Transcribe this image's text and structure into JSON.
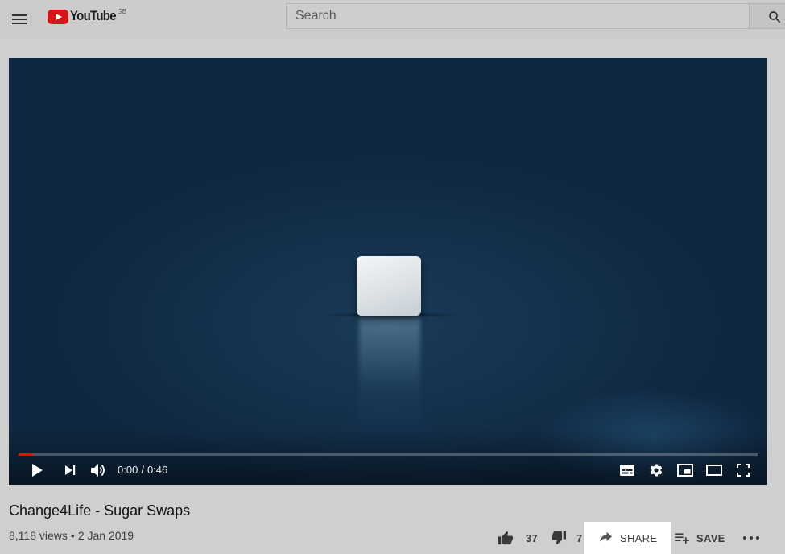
{
  "header": {
    "logo_text": "YouTube",
    "country_code": "GB",
    "search_placeholder": "Search"
  },
  "player": {
    "current_time": "0:00",
    "separator": "/",
    "duration": "0:46",
    "progress_fraction": 0.02
  },
  "video": {
    "title": "Change4Life - Sugar Swaps",
    "views": "8,118 views",
    "dot": "•",
    "date": "2 Jan 2019"
  },
  "actions": {
    "likes": "37",
    "dislikes": "7",
    "share_label": "SHARE",
    "save_label": "SAVE"
  },
  "colors": {
    "progress_played": "#ff0000",
    "logo_red": "#ff0000",
    "share_highlight": "#ffffff"
  },
  "icons": [
    "menu-icon",
    "youtube-logo-icon",
    "search-icon",
    "play-icon",
    "next-icon",
    "volume-icon",
    "subtitles-icon",
    "settings-icon",
    "miniplayer-icon",
    "theater-mode-icon",
    "fullscreen-icon",
    "thumbs-up-icon",
    "thumbs-down-icon",
    "share-icon",
    "playlist-add-icon",
    "more-icon"
  ]
}
